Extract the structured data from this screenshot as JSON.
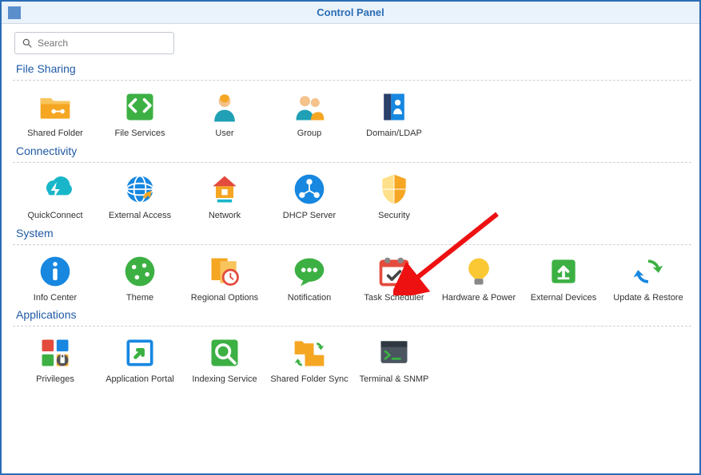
{
  "window": {
    "title": "Control Panel"
  },
  "search": {
    "placeholder": "Search"
  },
  "sections": {
    "file_sharing": {
      "title": "File Sharing",
      "items": [
        {
          "id": "shared-folder",
          "label": "Shared Folder"
        },
        {
          "id": "file-services",
          "label": "File Services"
        },
        {
          "id": "user",
          "label": "User"
        },
        {
          "id": "group",
          "label": "Group"
        },
        {
          "id": "domain-ldap",
          "label": "Domain/LDAP"
        }
      ]
    },
    "connectivity": {
      "title": "Connectivity",
      "items": [
        {
          "id": "quickconnect",
          "label": "QuickConnect"
        },
        {
          "id": "external-access",
          "label": "External Access"
        },
        {
          "id": "network",
          "label": "Network"
        },
        {
          "id": "dhcp-server",
          "label": "DHCP Server"
        },
        {
          "id": "security",
          "label": "Security"
        }
      ]
    },
    "system": {
      "title": "System",
      "items": [
        {
          "id": "info-center",
          "label": "Info Center"
        },
        {
          "id": "theme",
          "label": "Theme"
        },
        {
          "id": "regional-options",
          "label": "Regional Options"
        },
        {
          "id": "notification",
          "label": "Notification"
        },
        {
          "id": "task-scheduler",
          "label": "Task Scheduler"
        },
        {
          "id": "hardware-power",
          "label": "Hardware & Power"
        },
        {
          "id": "external-devices",
          "label": "External Devices"
        },
        {
          "id": "update-restore",
          "label": "Update & Restore"
        }
      ]
    },
    "applications": {
      "title": "Applications",
      "items": [
        {
          "id": "privileges",
          "label": "Privileges"
        },
        {
          "id": "application-portal",
          "label": "Application Portal"
        },
        {
          "id": "indexing-service",
          "label": "Indexing Service"
        },
        {
          "id": "shared-folder-sync",
          "label": "Shared Folder Sync"
        },
        {
          "id": "terminal-snmp",
          "label": "Terminal & SNMP"
        }
      ]
    }
  },
  "annotation": {
    "arrow_points_to": "task-scheduler",
    "arrow_color": "#e11"
  }
}
